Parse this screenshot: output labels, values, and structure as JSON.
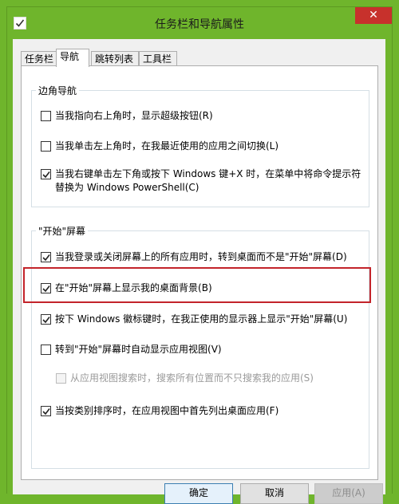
{
  "window": {
    "title": "任务栏和导航属性",
    "close_symbol": "✕"
  },
  "tabs": [
    {
      "label": "任务栏",
      "active": false
    },
    {
      "label": "导航",
      "active": true
    },
    {
      "label": "跳转列表",
      "active": false
    },
    {
      "label": "工具栏",
      "active": false
    }
  ],
  "corner_nav": {
    "label": "边角导航",
    "options": [
      {
        "label": "当我指向右上角时，显示超级按钮(R)",
        "checked": false
      },
      {
        "label": "当我单击左上角时，在我最近使用的应用之间切换(L)",
        "checked": false
      },
      {
        "label": "当我右键单击左下角或按下 Windows 键+X 时，在菜单中将命令提示符替换为 Windows PowerShell(C)",
        "checked": true
      }
    ]
  },
  "start_screen": {
    "label": "\"开始\"屏幕",
    "options": [
      {
        "label": "当我登录或关闭屏幕上的所有应用时，转到桌面而不是\"开始\"屏幕(D)",
        "checked": true
      },
      {
        "label": "在\"开始\"屏幕上显示我的桌面背景(B)",
        "checked": true
      },
      {
        "label": "按下 Windows 徽标键时，在我正使用的显示器上显示\"开始\"屏幕(U)",
        "checked": true
      },
      {
        "label": "转到\"开始\"屏幕时自动显示应用视图(V)",
        "checked": false
      },
      {
        "label": "从应用视图搜索时，搜索所有位置而不只搜索我的应用(S)",
        "checked": false,
        "disabled": true
      },
      {
        "label": "当按类别排序时，在应用视图中首先列出桌面应用(F)",
        "checked": true
      }
    ]
  },
  "buttons": {
    "ok": "确定",
    "cancel": "取消",
    "apply": "应用(A)"
  },
  "colors": {
    "desktop_background": "#6fb52c",
    "close_button": "#c7312c",
    "highlight_border": "#c3242a"
  }
}
